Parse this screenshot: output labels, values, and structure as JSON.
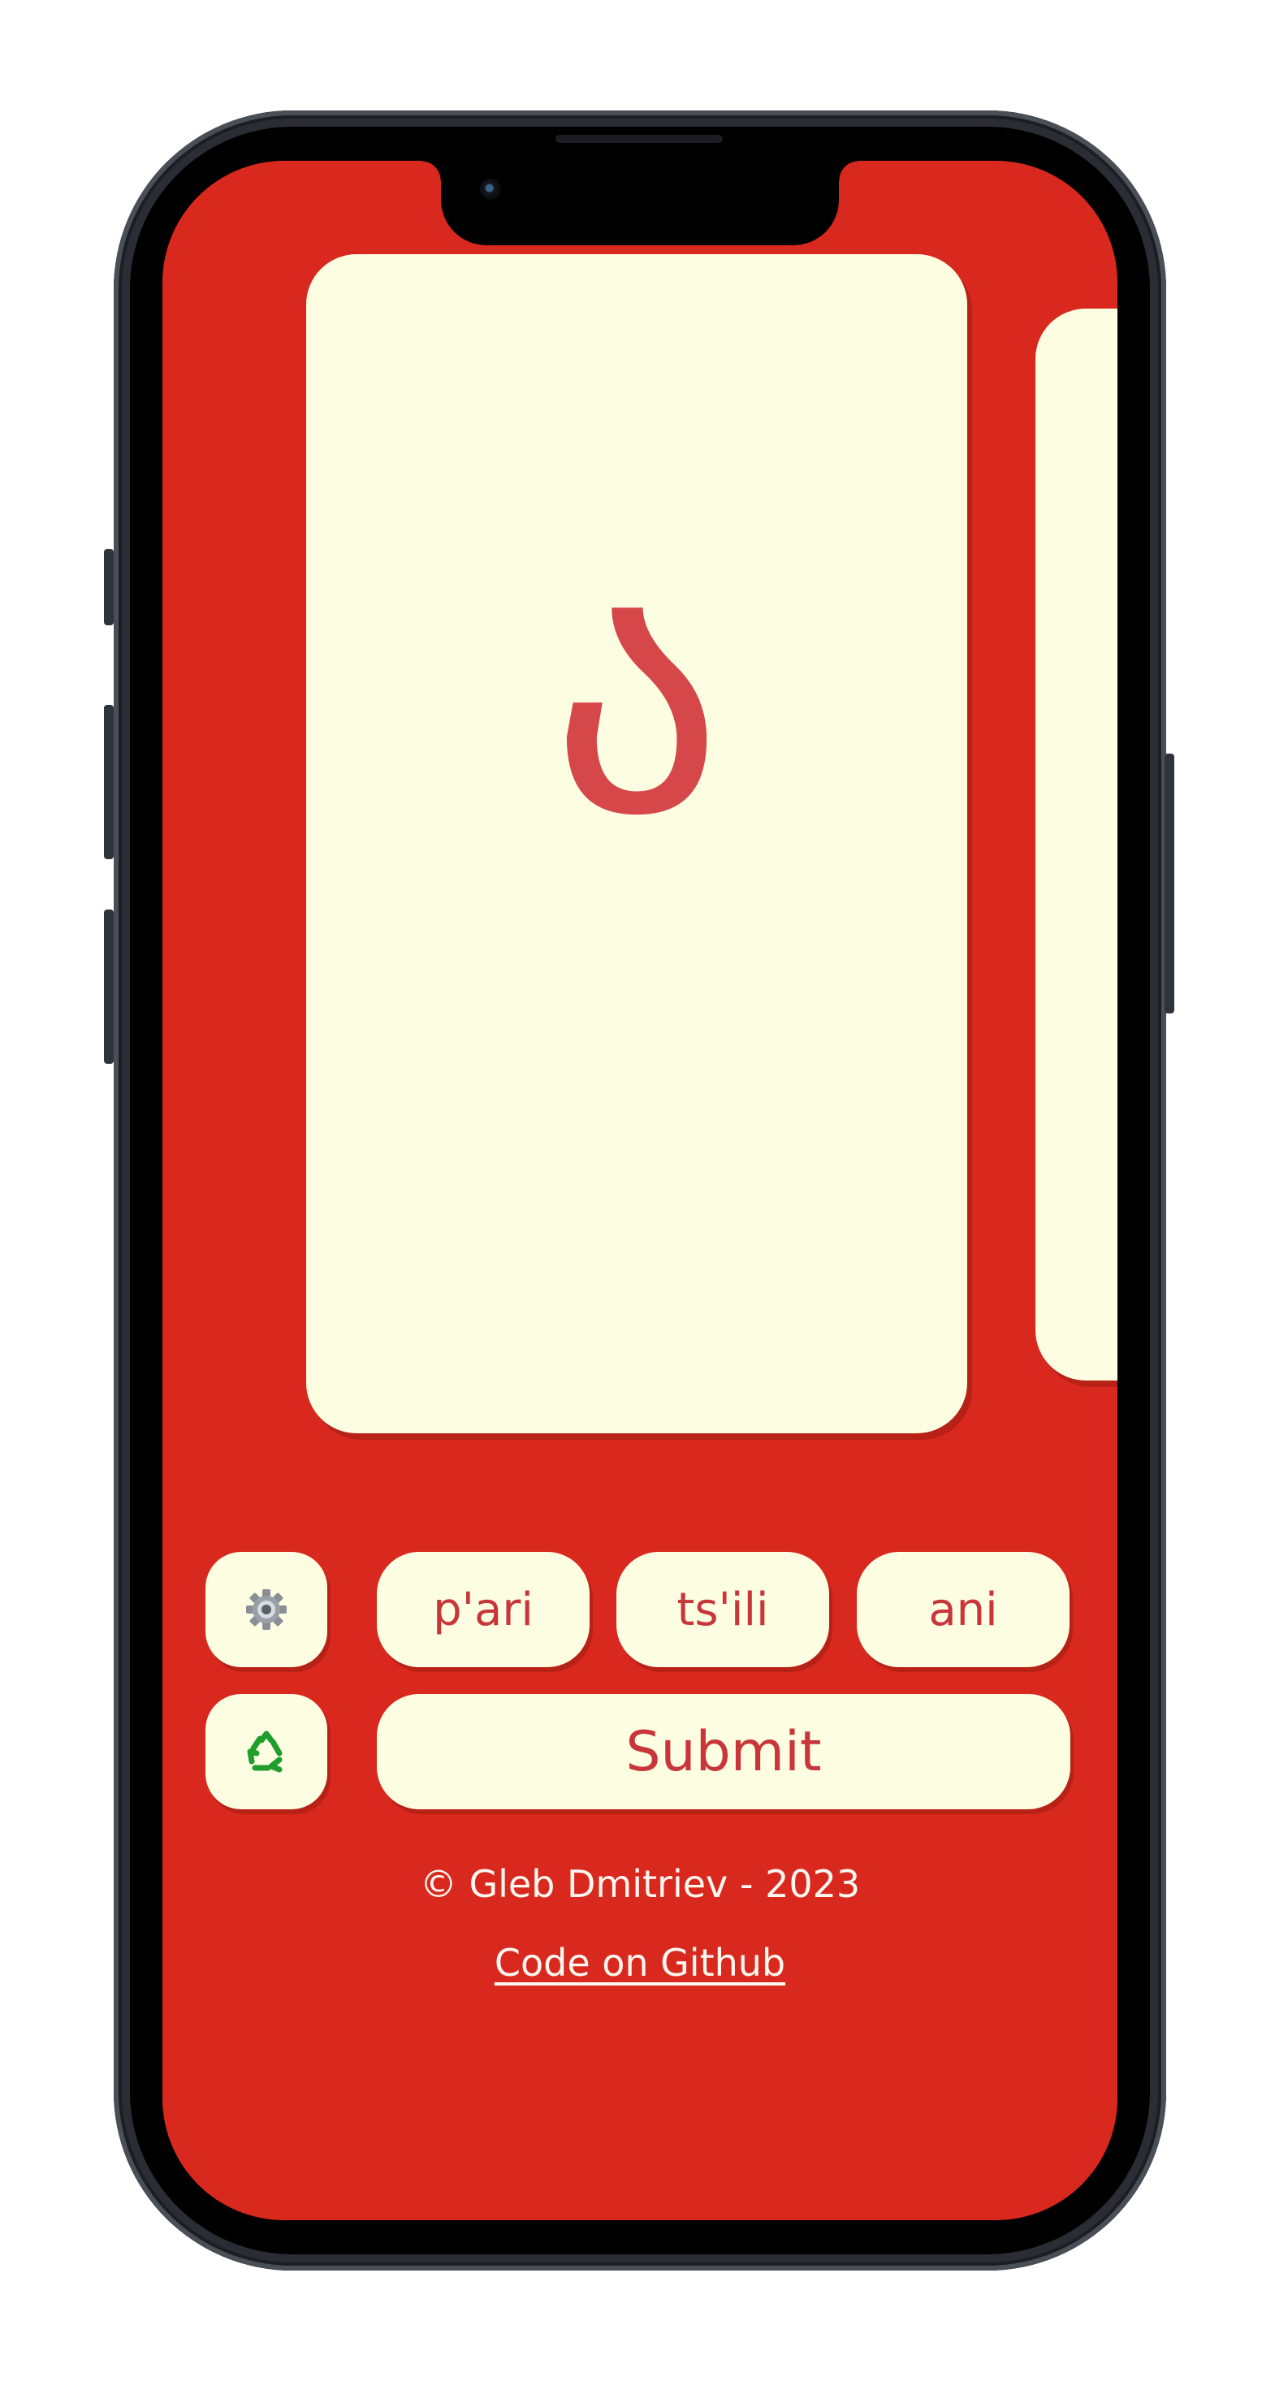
{
  "card": {
    "letter": "ა"
  },
  "controls": {
    "settings_icon": "gear-icon",
    "restart_icon": "recycle-icon",
    "choices": [
      "p'ari",
      "ts'ili",
      "ani"
    ],
    "submit_label": "Submit"
  },
  "footer": {
    "credit": "© Gleb Dmitriev - 2023",
    "github_link": "Code on Github"
  },
  "colors": {
    "background": "#d9281e",
    "card": "#fdfde2",
    "accent_text": "#c8363a",
    "letter": "#d6474a"
  }
}
